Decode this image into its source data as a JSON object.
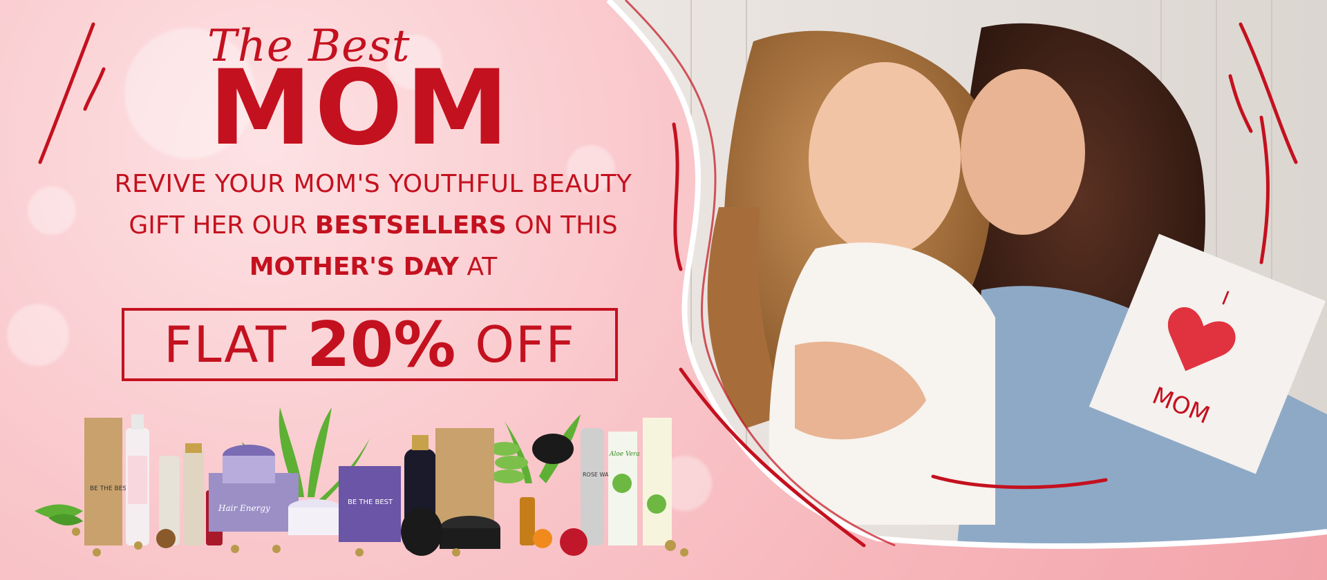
{
  "headline": {
    "script": "The Best",
    "main": "MOM"
  },
  "copy": {
    "line1": "REVIVE YOUR MOM'S YOUTHFUL BEAUTY",
    "line2_prefix": "GIFT HER OUR ",
    "line2_bold": "BESTSELLERS",
    "line2_suffix": " ON THIS",
    "line3_bold": "MOTHER'S DAY",
    "line3_suffix": " AT"
  },
  "offer": {
    "prefix": "FLAT",
    "amount": "20%",
    "suffix": "OFF"
  },
  "card": {
    "line1": "I",
    "line2": "MOM"
  },
  "product_labels": {
    "box_brand": "BE THE BEST",
    "sub_brand": "Hair Energy",
    "rose_water": "ROSE WATER",
    "aloe_vera": "Aloe Vera"
  },
  "colors": {
    "brand_red": "#c4111f",
    "background_pink": "#f7b9bd"
  }
}
